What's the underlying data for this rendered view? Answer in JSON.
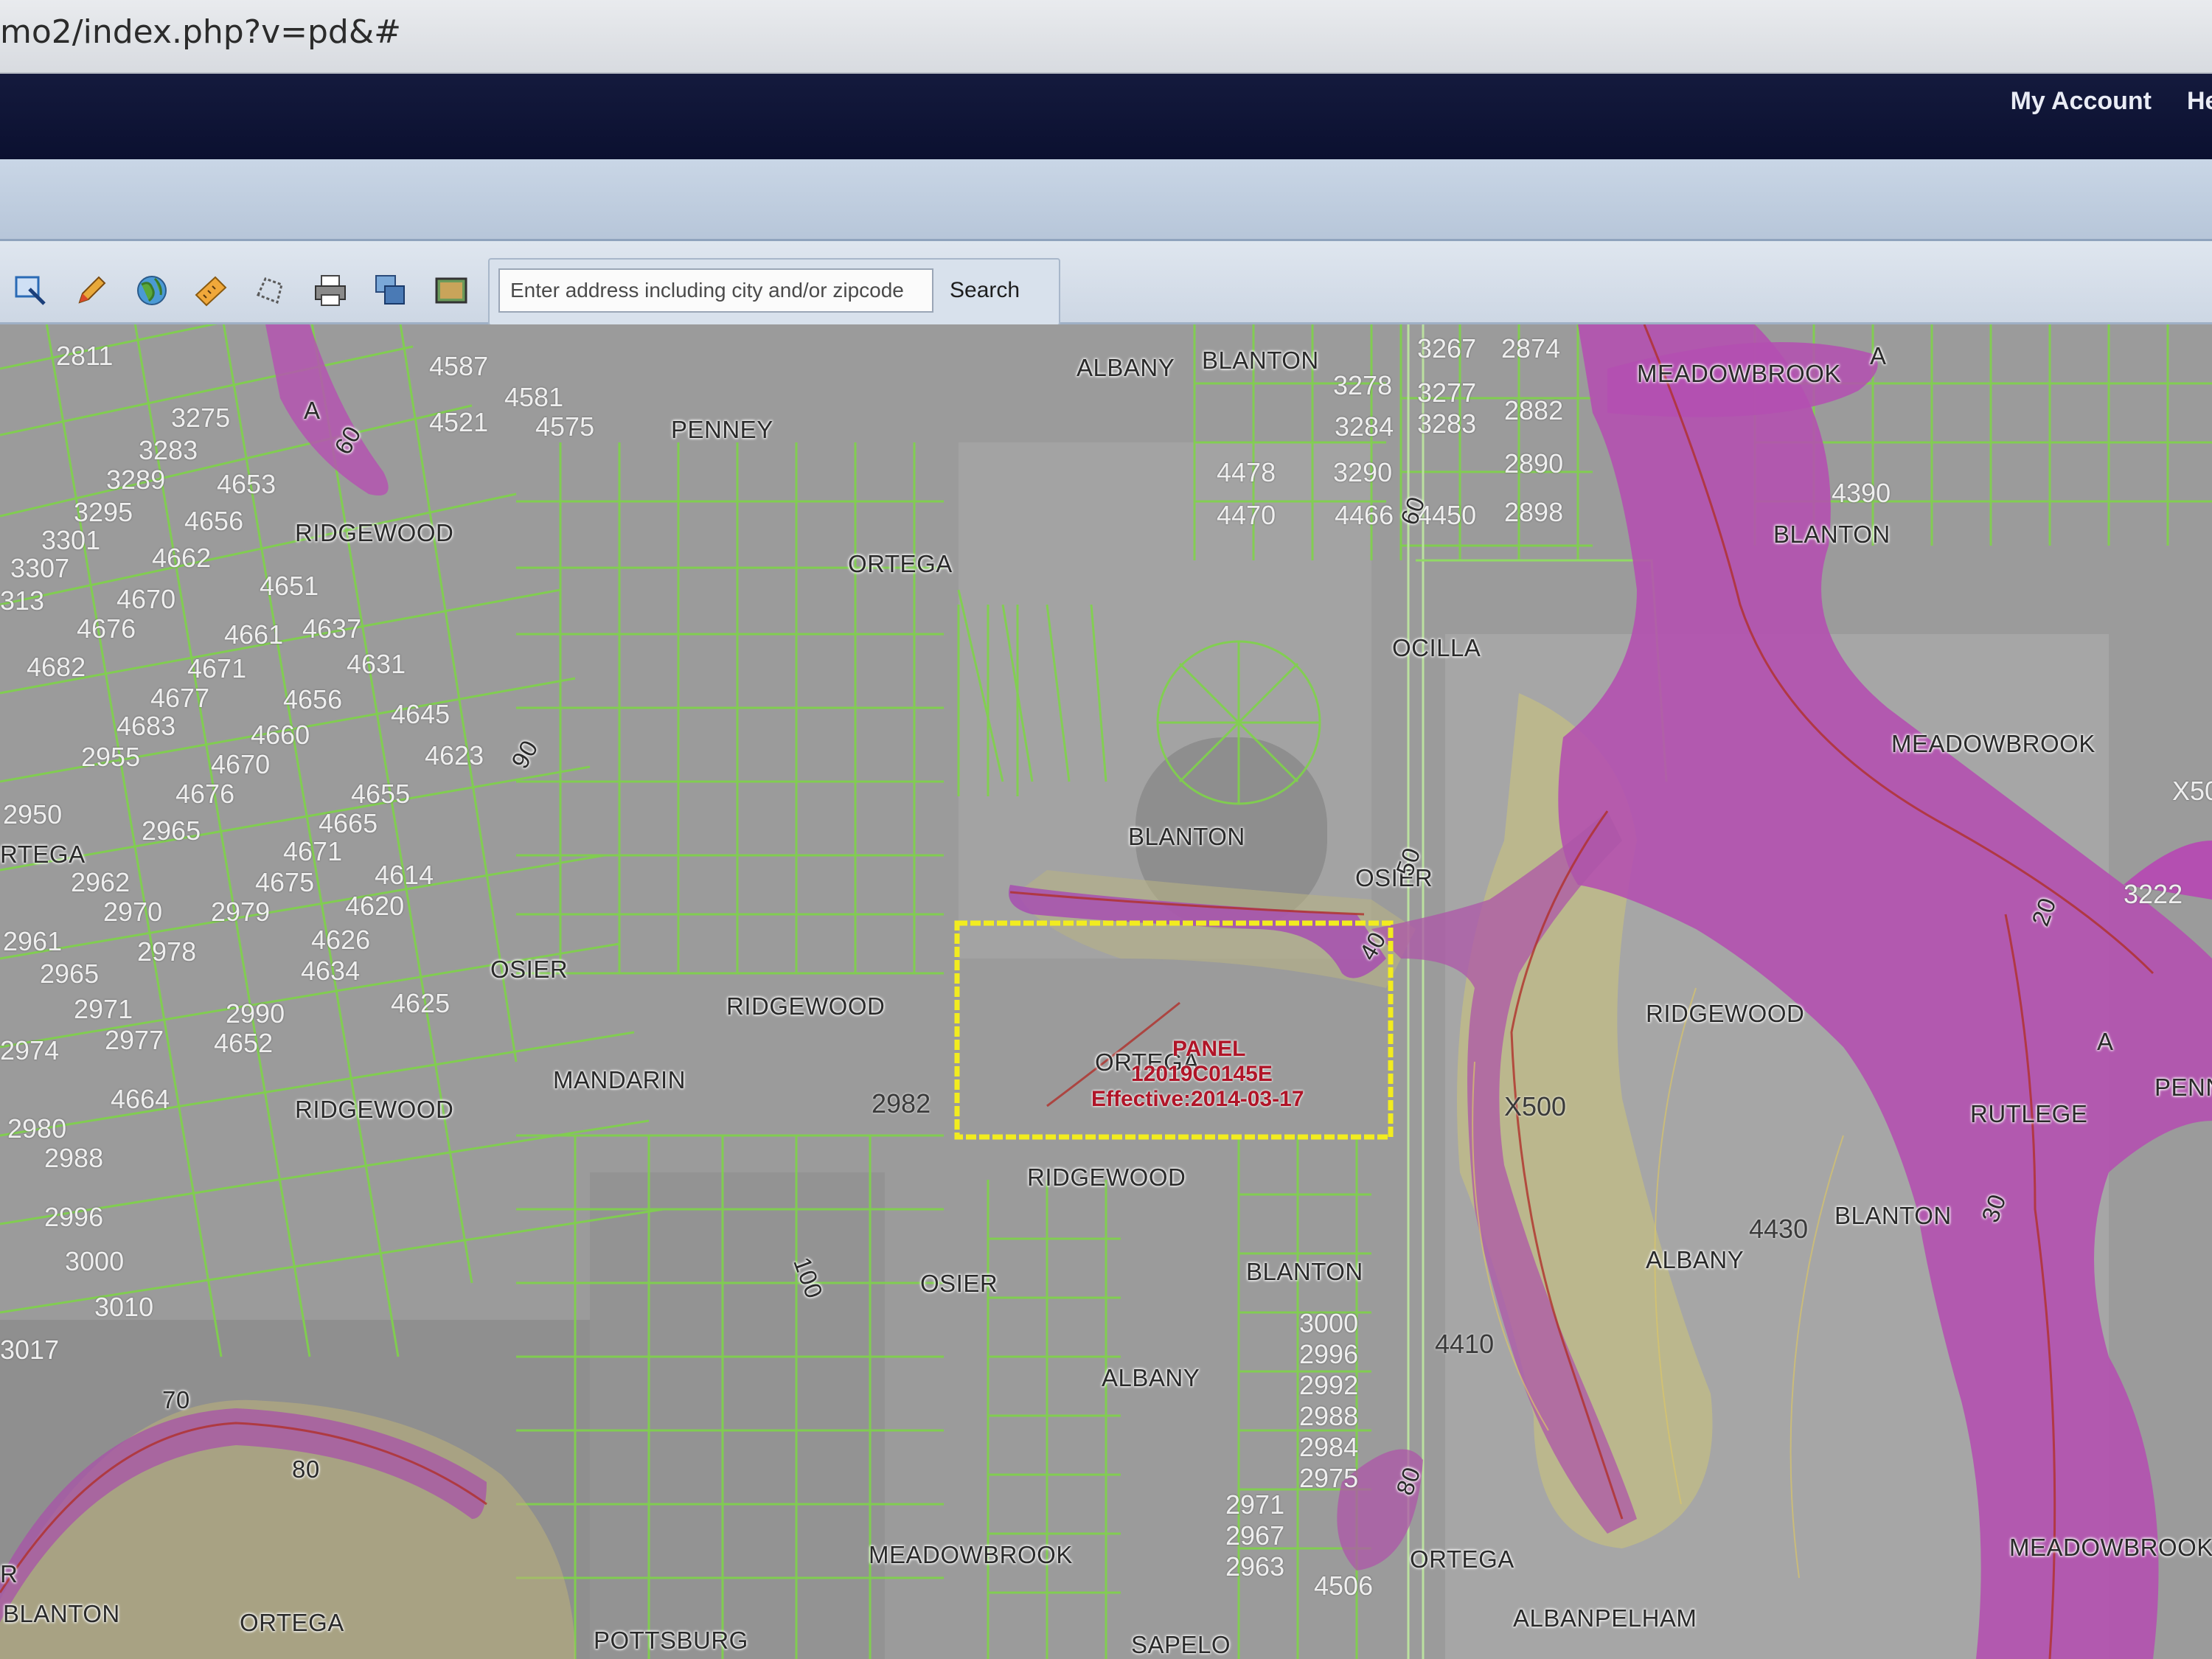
{
  "browser": {
    "url": "mo2/index.php?v=pd&#"
  },
  "nav": {
    "my_account": "My Account",
    "next_item_cut": "He"
  },
  "toolbar": {
    "tools": [
      {
        "name": "zoom-box-icon",
        "color": "#2a6ab5"
      },
      {
        "name": "pencil-icon",
        "color": "#d08a1a"
      },
      {
        "name": "globe-icon",
        "color": "#3a8a2a"
      },
      {
        "name": "measure-icon",
        "color": "#d07a1a"
      },
      {
        "name": "polygon-select-icon",
        "color": "#7a7a7a"
      },
      {
        "name": "print-icon",
        "color": "#555555"
      },
      {
        "name": "layers-icon",
        "color": "#2a5aa5"
      },
      {
        "name": "basemap-icon",
        "color": "#3a6a3a"
      }
    ],
    "search_placeholder": "Enter address including city and/or zipcode",
    "search_label": "Search"
  },
  "map": {
    "streets": [
      "ALBANY",
      "BLANTON",
      "PENNEY",
      "RIDGEWOOD",
      "ORTEGA",
      "MEADOWBROOK",
      "BLANTON",
      "OCILLA",
      "MEADOWBROOK",
      "RTEGA",
      "BLANTON",
      "OSIER",
      "OSIER",
      "RIDGEWOOD",
      "RIDGEWOOD",
      "MANDARIN",
      "RIDGEWOOD",
      "ORTEGA",
      "RUTLEGE",
      "PENN",
      "RIDGEWOOD",
      "BLANTON",
      "ALBANY",
      "OSIER",
      "BLANTON",
      "ALBANY",
      "MEADOWBROOK",
      "ORTEGA",
      "ALBANPELHAM",
      "MEADOWBROOK",
      "BLANTON",
      "ORTEGA",
      "POTTSBURG",
      "SAPELO",
      "R"
    ],
    "parcels": [
      "2811",
      "4587",
      "4581",
      "3275",
      "4521",
      "4575",
      "3283",
      "4653",
      "3289",
      "3295",
      "4656",
      "3301",
      "4662",
      "3307",
      "4651",
      "313",
      "4670",
      "4637",
      "4676",
      "4661",
      "4682",
      "4671",
      "4631",
      "4677",
      "4656",
      "4683",
      "4645",
      "4660",
      "2955",
      "4670",
      "4623",
      "4676",
      "4655",
      "2950",
      "4665",
      "2965",
      "4671",
      "4675",
      "2962",
      "4614",
      "2970",
      "2979",
      "4620",
      "2961",
      "2978",
      "4626",
      "2965",
      "4634",
      "2971",
      "4625",
      "2990",
      "2977",
      "4652",
      "2974",
      "4664",
      "2980",
      "2988",
      "2996",
      "3000",
      "3010",
      "3017",
      "3267",
      "2874",
      "3277",
      "2882",
      "3278",
      "3283",
      "3284",
      "2890",
      "3290",
      "4478",
      "4470",
      "4466",
      "4450",
      "2898",
      "4390",
      "2982",
      "3222",
      "3000",
      "2996",
      "2992",
      "2988",
      "2984",
      "2975",
      "2971",
      "2967",
      "2963",
      "4506",
      "4410",
      "4430",
      "X500",
      "X50"
    ],
    "contours": [
      "A",
      "60",
      "90",
      "50",
      "40",
      "60",
      "20",
      "A",
      "30",
      "100",
      "80",
      "70",
      "80",
      "A"
    ],
    "panel": {
      "line1": "PANEL",
      "line2": "12019C0145E",
      "line3": "Effective:2014-03-17"
    }
  }
}
